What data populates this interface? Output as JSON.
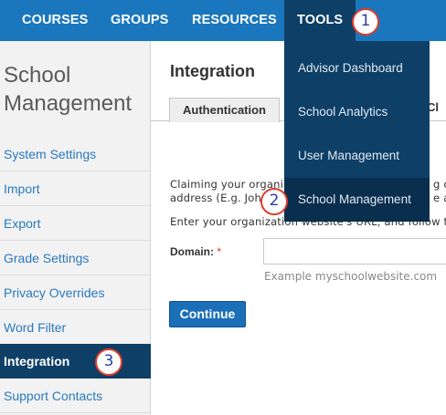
{
  "topnav": {
    "items": [
      "COURSES",
      "GROUPS",
      "RESOURCES",
      "TOOLS"
    ]
  },
  "sidebar": {
    "title_line1": "School",
    "title_line2": "Management",
    "items": [
      {
        "label": "System Settings"
      },
      {
        "label": "Import"
      },
      {
        "label": "Export"
      },
      {
        "label": "Grade Settings"
      },
      {
        "label": "Privacy Overrides"
      },
      {
        "label": "Word Filter"
      },
      {
        "label": "Integration"
      },
      {
        "label": "Support Contacts"
      }
    ]
  },
  "main": {
    "title": "Integration",
    "tabs": [
      "Authentication",
      "Cl"
    ],
    "text_line1": "Claiming your organi",
    "text_line1_tail": "g or",
    "text_line2": "address (E.g. Joh",
    "text_line2_tail": "e a",
    "text_line3": "Enter your organization website's URL, and follow th",
    "domain_label": "Domain:",
    "domain_required": "*",
    "domain_value": "",
    "domain_example": "Example myschoolwebsite.com",
    "continue_label": "Continue"
  },
  "dropdown": {
    "items": [
      "Advisor Dashboard",
      "School Analytics",
      "User Management",
      "School Management"
    ]
  },
  "badges": [
    "1",
    "2",
    "3"
  ]
}
